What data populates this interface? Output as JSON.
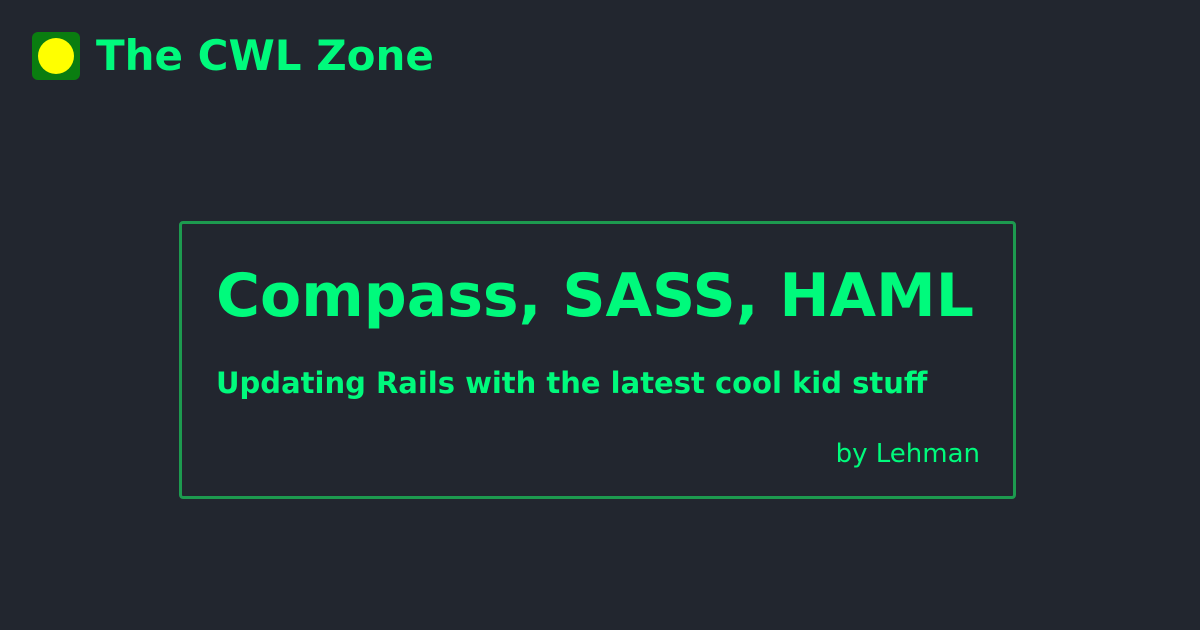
{
  "site": {
    "name": "The CWL Zone",
    "logo_icon": "yellow-dot-icon",
    "logo_background": "#0a7d10",
    "logo_dot_color": "#ffff00"
  },
  "post": {
    "title": "Compass, SASS, HAML",
    "subtitle": "Updating Rails with the latest cool kid stuff",
    "author": "by Lehman"
  },
  "theme": {
    "background": "#22262f",
    "accent": "#00fa7c",
    "border": "#1d9a4f"
  }
}
